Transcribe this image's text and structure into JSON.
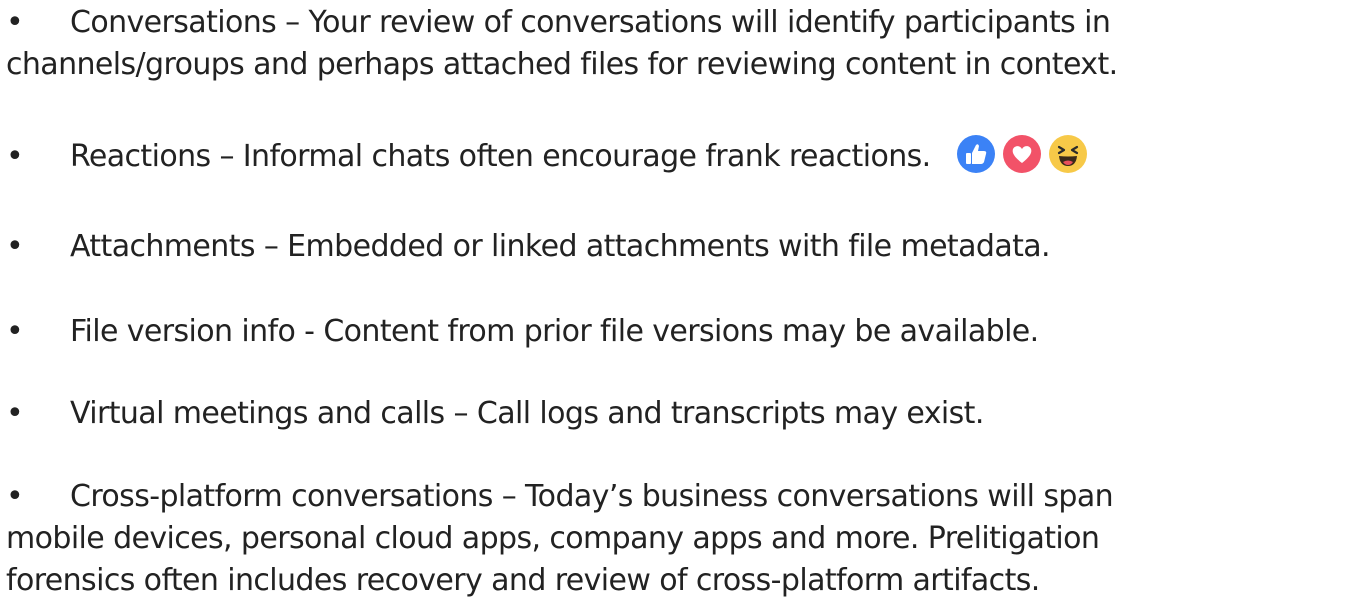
{
  "bullet_char": "•",
  "items": [
    {
      "lines": [
        "Conversations – Your review of conversations will identify participants in",
        "channels/groups and perhaps attached files for reviewing content in context."
      ]
    },
    {
      "lines": [
        "Reactions – Informal chats often encourage frank reactions."
      ],
      "reaction_icons": [
        "like-icon",
        "heart-icon",
        "laughing-emoji-icon"
      ]
    },
    {
      "lines": [
        "Attachments – Embedded or linked attachments with file metadata."
      ]
    },
    {
      "lines": [
        "File version info - Content from prior file versions may be available."
      ]
    },
    {
      "lines": [
        "Virtual meetings and calls – Call logs and transcripts may exist."
      ]
    },
    {
      "lines": [
        "Cross-platform conversations – Today’s business conversations will span",
        "mobile devices, personal cloud apps, company apps and more.  Prelitigation",
        "forensics often includes recovery and review of cross-platform artifacts."
      ]
    }
  ],
  "colors": {
    "text": "#222222",
    "like": "#3b82f6",
    "heart": "#f25268",
    "emoji": "#f7c948"
  }
}
